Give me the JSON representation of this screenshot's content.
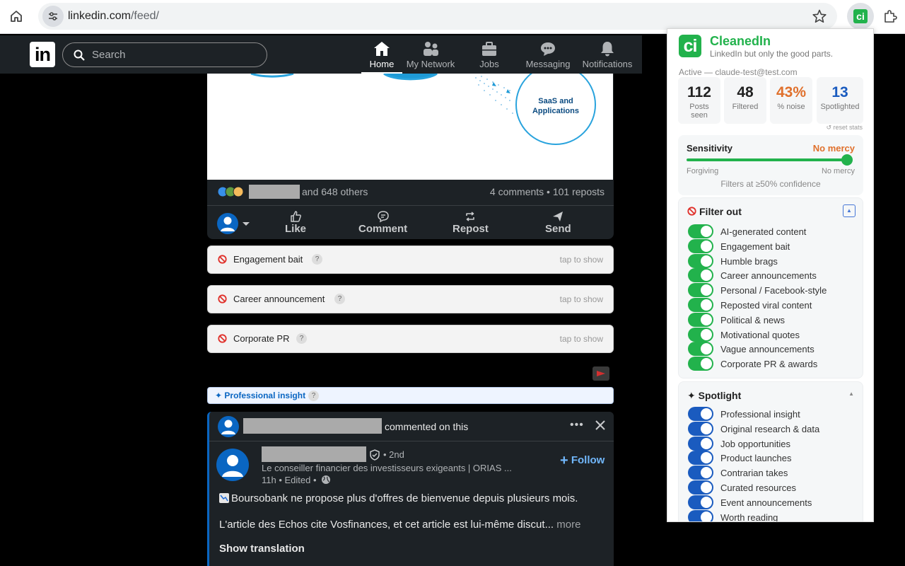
{
  "browser": {
    "url_host": "linkedin.com",
    "url_path": "/feed/"
  },
  "linkedin": {
    "logo": "in",
    "search_placeholder": "Search",
    "nav": [
      {
        "label": "Home",
        "icon": "home-icon",
        "active": true
      },
      {
        "label": "My Network",
        "icon": "network-icon"
      },
      {
        "label": "Jobs",
        "icon": "briefcase-icon"
      },
      {
        "label": "Messaging",
        "icon": "messaging-icon"
      },
      {
        "label": "Notifications",
        "icon": "bell-icon"
      }
    ]
  },
  "post1": {
    "illustration_label_line1": "SaaS and",
    "illustration_label_line2": "Applications",
    "reactions_text": "and 648 others",
    "comments_reposts": "4 comments • 101 reposts",
    "actions": {
      "like": "Like",
      "comment": "Comment",
      "repost": "Repost",
      "send": "Send"
    }
  },
  "filtered": [
    {
      "label": "Engagement bait",
      "tap": "tap to show"
    },
    {
      "label": "Career announcement",
      "tap": "tap to show"
    },
    {
      "label": "Corporate PR",
      "tap": "tap to show"
    }
  ],
  "insight_bar": {
    "label": "✦ Professional insight",
    "help": "?"
  },
  "post2": {
    "commented": "commented on this",
    "degree": "• 2nd",
    "headline": "Le conseiller financier des investisseurs exigeants | ORIAS ...",
    "time": "11h • Edited •",
    "follow": "Follow",
    "text1": "Boursobank ne propose plus d'offres de bienvenue depuis plusieurs mois.",
    "text2": "L'article des Echos cite Vosfinances, et cet article est lui-même discut...",
    "more": "more",
    "show_translation": "Show translation"
  },
  "popup": {
    "logo": "ci",
    "title": "CleanedIn",
    "tagline": "LinkedIn but only the good parts.",
    "active": "Active — claude-test@test.com",
    "stats": [
      {
        "value": "112",
        "label": "Posts seen",
        "color": "#222222"
      },
      {
        "value": "48",
        "label": "Filtered",
        "color": "#222222"
      },
      {
        "value": "43%",
        "label": "% noise",
        "color": "#e0702c"
      },
      {
        "value": "13",
        "label": "Spotlighted",
        "color": "#1a5bbf"
      }
    ],
    "reset": "↺ reset stats",
    "sensitivity": {
      "title": "Sensitivity",
      "value": "No mercy",
      "level": 1.0,
      "low": "Forgiving",
      "high": "No mercy",
      "confidence": "Filters at ≥50% confidence"
    },
    "filter_out": {
      "title": "Filter out",
      "items": [
        "AI-generated content",
        "Engagement bait",
        "Humble brags",
        "Career announcements",
        "Personal / Facebook-style",
        "Reposted viral content",
        "Political & news",
        "Motivational quotes",
        "Vague announcements",
        "Corporate PR & awards"
      ]
    },
    "spotlight": {
      "title": "✦ Spotlight",
      "items": [
        "Professional insight",
        "Original research & data",
        "Job opportunities",
        "Product launches",
        "Contrarian takes",
        "Curated resources",
        "Event announcements",
        "Worth reading"
      ]
    },
    "colors": {
      "brand": "#22b24c",
      "filter_toggle": "#22b24c",
      "spotlight_toggle": "#1a5bbf"
    }
  }
}
